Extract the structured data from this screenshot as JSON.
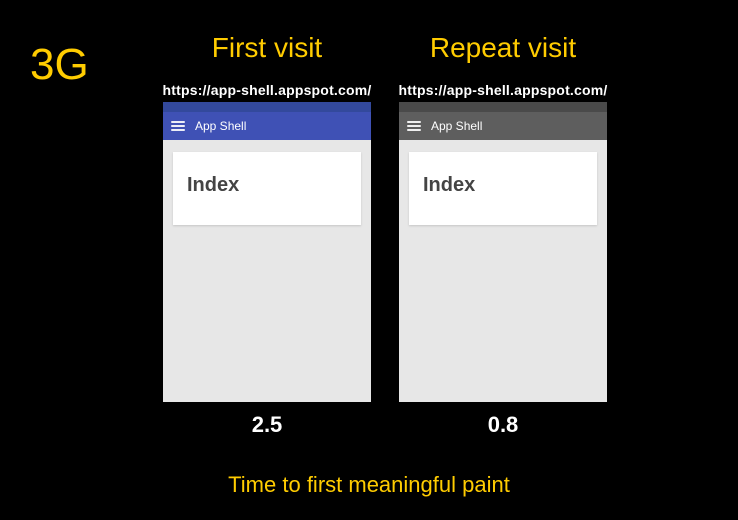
{
  "network_label": "3G",
  "caption": "Time to first meaningful paint",
  "columns": [
    {
      "heading": "First visit",
      "url": "https://app-shell.appspot.com/",
      "app_title": "App Shell",
      "page_heading": "Index",
      "time_seconds": "2.5",
      "theme": "blue"
    },
    {
      "heading": "Repeat visit",
      "url": "https://app-shell.appspot.com/",
      "app_title": "App Shell",
      "page_heading": "Index",
      "time_seconds": "0.8",
      "theme": "gray"
    }
  ]
}
